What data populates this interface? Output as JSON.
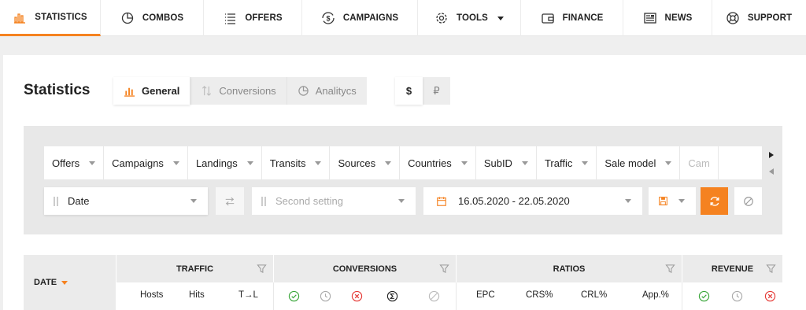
{
  "nav": {
    "items": [
      {
        "label": "STATISTICS",
        "icon": "bar-chart-icon",
        "active": true
      },
      {
        "label": "COMBOS",
        "icon": "pie-chart-icon"
      },
      {
        "label": "OFFERS",
        "icon": "list-icon"
      },
      {
        "label": "CAMPAIGNS",
        "icon": "dollar-cycle-icon"
      },
      {
        "label": "TOOLS",
        "icon": "gear-icon",
        "dropdown": true
      },
      {
        "label": "FINANCE",
        "icon": "wallet-icon"
      },
      {
        "label": "NEWS",
        "icon": "newspaper-icon"
      },
      {
        "label": "SUPPORT",
        "icon": "lifebuoy-icon"
      }
    ]
  },
  "page": {
    "title": "Statistics"
  },
  "tabs": [
    {
      "label": "General",
      "icon": "bar-chart-icon",
      "active": true
    },
    {
      "label": "Conversions",
      "icon": "sort-arrows-icon"
    },
    {
      "label": "Analityсs",
      "icon": "pie-chart-icon"
    }
  ],
  "currency": [
    {
      "label": "$",
      "active": true
    },
    {
      "label": "₽"
    }
  ],
  "groupings": [
    "Offers",
    "Campaigns",
    "Landings",
    "Transits",
    "Sources",
    "Countries",
    "SubID",
    "Traffic",
    "Sale model",
    "Cam"
  ],
  "controls": {
    "primary": "Date",
    "secondary_placeholder": "Second setting",
    "date_range": "16.05.2020 - 22.05.2020"
  },
  "table": {
    "date_header": "DATE",
    "groups": [
      {
        "label": "TRAFFIC",
        "columns": [
          "Hosts",
          "Hits",
          "T→L"
        ]
      },
      {
        "label": "CONVERSIONS",
        "columns": [
          "approved-icon",
          "pending-icon",
          "rejected-icon",
          "total-icon",
          "trash-icon"
        ]
      },
      {
        "label": "RATIOS",
        "columns": [
          "EPC",
          "CRS%",
          "CRL%",
          "App.%"
        ]
      },
      {
        "label": "REVENUE",
        "columns": [
          "approved-icon",
          "pending-icon",
          "rejected-icon"
        ]
      }
    ]
  },
  "colors": {
    "accent": "#f58220",
    "approved": "#3aa63a",
    "rejected": "#e53935",
    "muted": "#aaaaaa"
  }
}
